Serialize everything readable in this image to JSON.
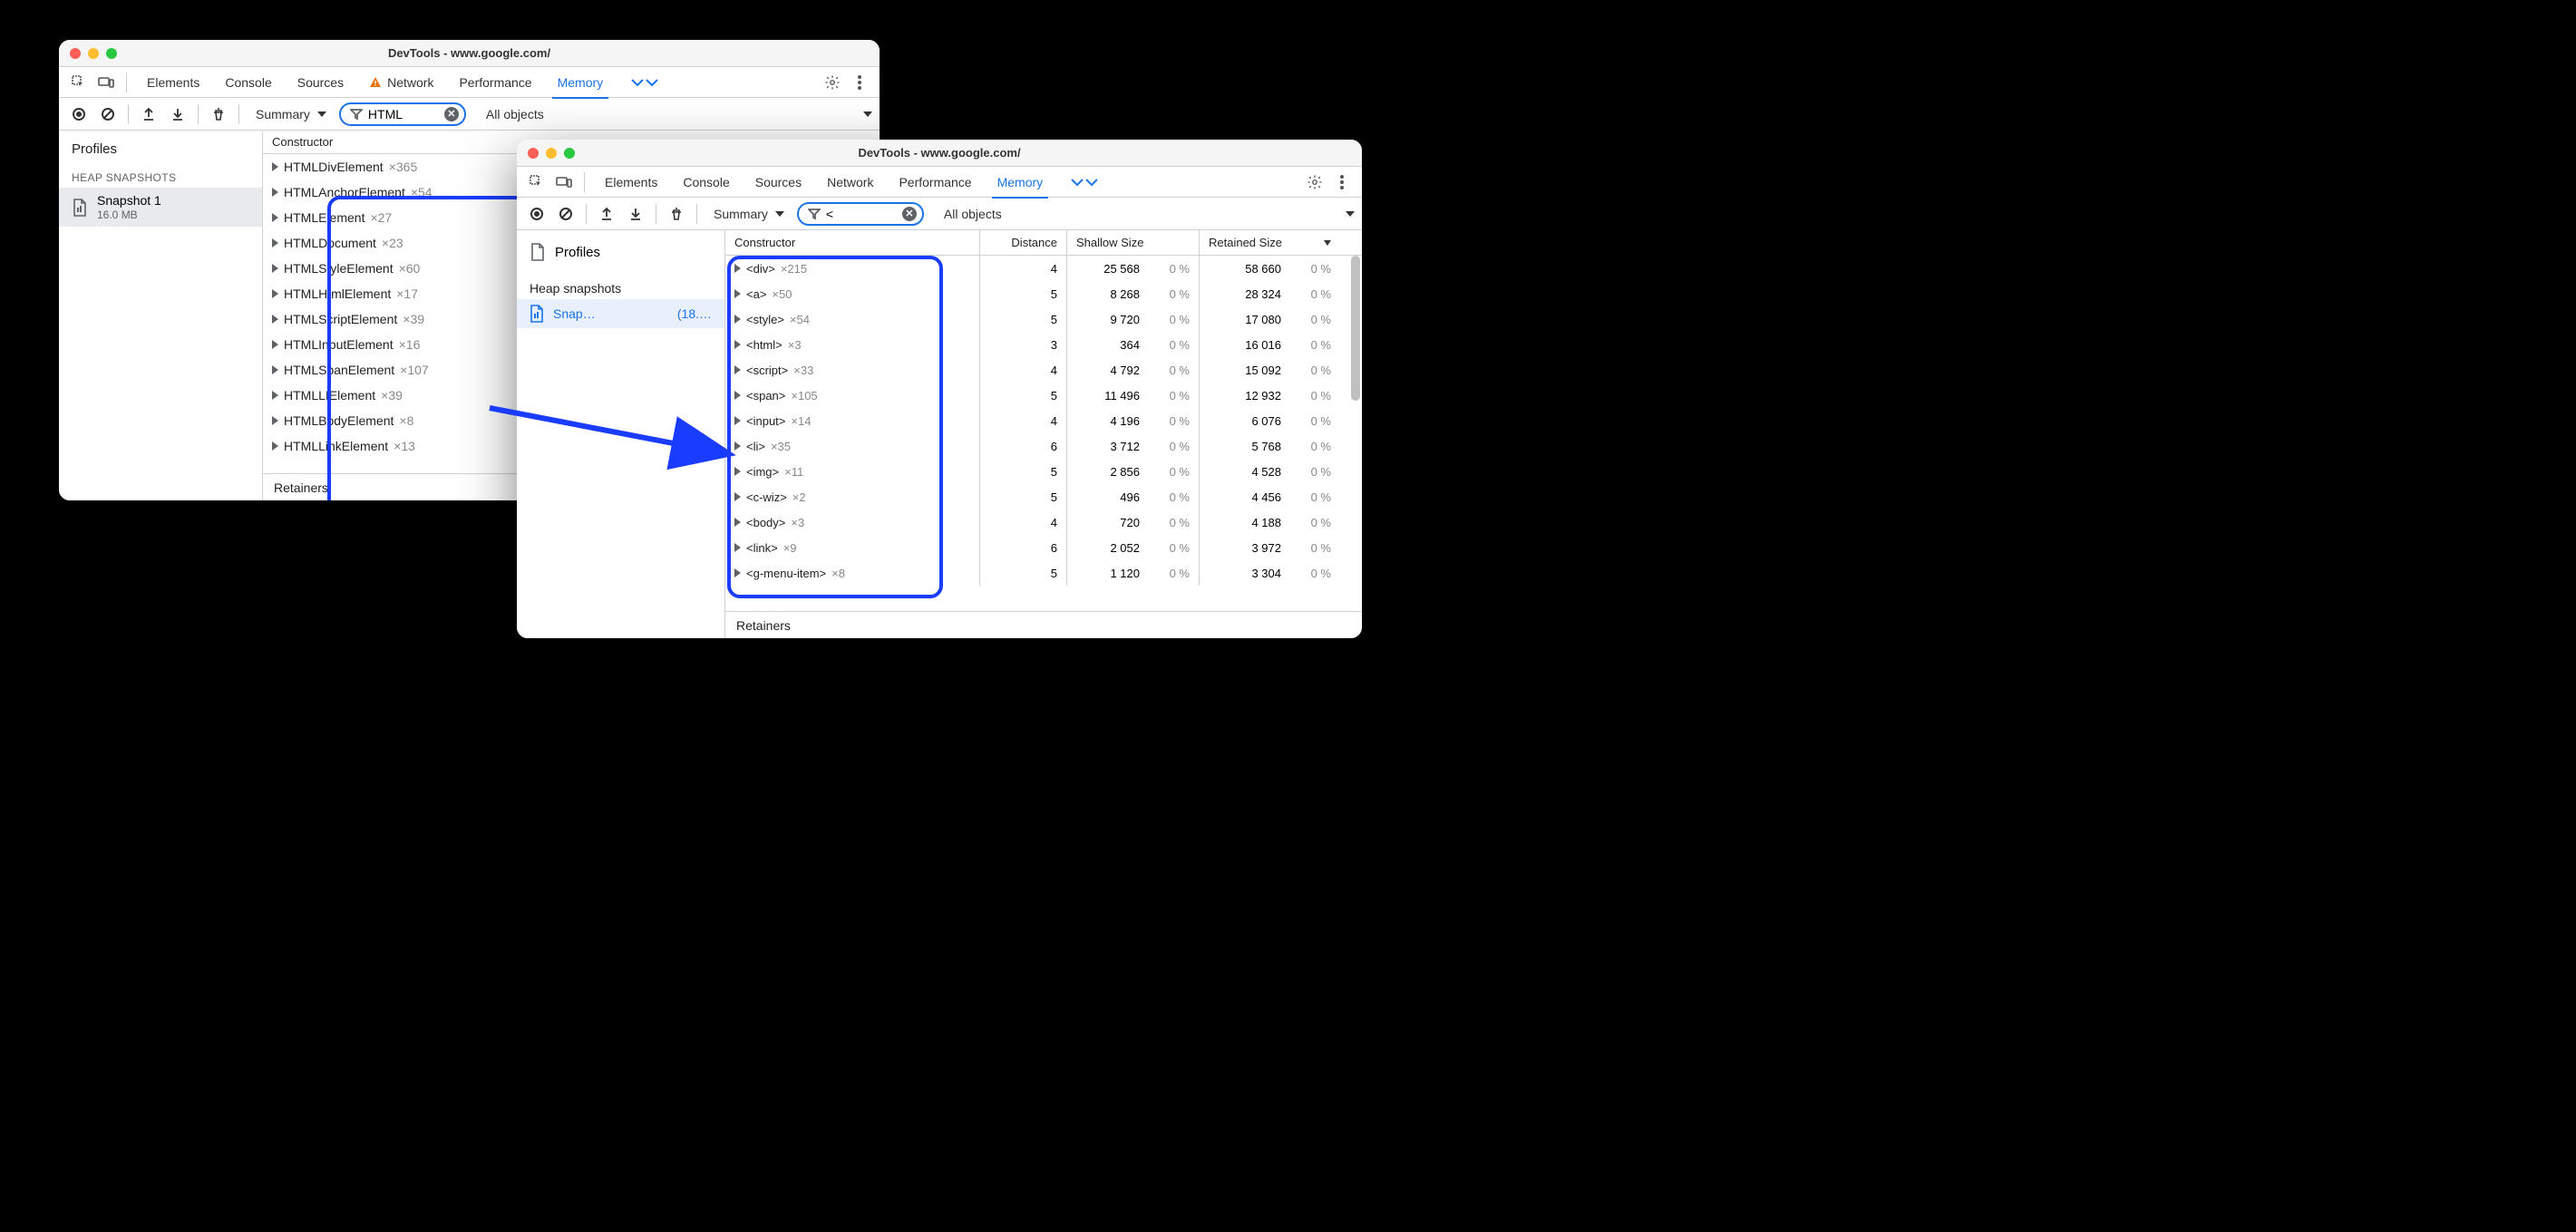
{
  "window1": {
    "title": "DevTools - www.google.com/",
    "tabs": [
      "Elements",
      "Console",
      "Sources",
      "Network",
      "Performance",
      "Memory"
    ],
    "warn_tab_index": 3,
    "active_tab_index": 5,
    "dropdown": "Summary",
    "filter_value": "HTML",
    "objects_dropdown": "All objects",
    "sidebar": {
      "title": "Profiles",
      "section": "HEAP SNAPSHOTS",
      "snapshot": {
        "name": "Snapshot 1",
        "size": "16.0 MB"
      }
    },
    "col_header": "Constructor",
    "rows": [
      {
        "name": "HTMLDivElement",
        "count": "×365"
      },
      {
        "name": "HTMLAnchorElement",
        "count": "×54"
      },
      {
        "name": "HTMLElement",
        "count": "×27"
      },
      {
        "name": "HTMLDocument",
        "count": "×23"
      },
      {
        "name": "HTMLStyleElement",
        "count": "×60"
      },
      {
        "name": "HTMLHtmlElement",
        "count": "×17"
      },
      {
        "name": "HTMLScriptElement",
        "count": "×39"
      },
      {
        "name": "HTMLInputElement",
        "count": "×16"
      },
      {
        "name": "HTMLSpanElement",
        "count": "×107"
      },
      {
        "name": "HTMLLIElement",
        "count": "×39"
      },
      {
        "name": "HTMLBodyElement",
        "count": "×8"
      },
      {
        "name": "HTMLLinkElement",
        "count": "×13"
      }
    ],
    "retainers": "Retainers"
  },
  "window2": {
    "title": "DevTools - www.google.com/",
    "tabs": [
      "Elements",
      "Console",
      "Sources",
      "Network",
      "Performance",
      "Memory"
    ],
    "active_tab_index": 5,
    "dropdown": "Summary",
    "filter_value": "<",
    "objects_dropdown": "All objects",
    "sidebar": {
      "title": "Profiles",
      "section": "Heap snapshots",
      "snapshot": {
        "name": "Snap…",
        "size": "(18.…"
      }
    },
    "columns": [
      "Constructor",
      "Distance",
      "Shallow Size",
      "Retained Size"
    ],
    "rows": [
      {
        "name": "<div>",
        "count": "×215",
        "dist": "4",
        "sh": "25 568",
        "shp": "0 %",
        "ret": "58 660",
        "retp": "0 %"
      },
      {
        "name": "<a>",
        "count": "×50",
        "dist": "5",
        "sh": "8 268",
        "shp": "0 %",
        "ret": "28 324",
        "retp": "0 %"
      },
      {
        "name": "<style>",
        "count": "×54",
        "dist": "5",
        "sh": "9 720",
        "shp": "0 %",
        "ret": "17 080",
        "retp": "0 %"
      },
      {
        "name": "<html>",
        "count": "×3",
        "dist": "3",
        "sh": "364",
        "shp": "0 %",
        "ret": "16 016",
        "retp": "0 %"
      },
      {
        "name": "<script>",
        "count": "×33",
        "dist": "4",
        "sh": "4 792",
        "shp": "0 %",
        "ret": "15 092",
        "retp": "0 %"
      },
      {
        "name": "<span>",
        "count": "×105",
        "dist": "5",
        "sh": "11 496",
        "shp": "0 %",
        "ret": "12 932",
        "retp": "0 %"
      },
      {
        "name": "<input>",
        "count": "×14",
        "dist": "4",
        "sh": "4 196",
        "shp": "0 %",
        "ret": "6 076",
        "retp": "0 %"
      },
      {
        "name": "<li>",
        "count": "×35",
        "dist": "6",
        "sh": "3 712",
        "shp": "0 %",
        "ret": "5 768",
        "retp": "0 %"
      },
      {
        "name": "<img>",
        "count": "×11",
        "dist": "5",
        "sh": "2 856",
        "shp": "0 %",
        "ret": "4 528",
        "retp": "0 %"
      },
      {
        "name": "<c-wiz>",
        "count": "×2",
        "dist": "5",
        "sh": "496",
        "shp": "0 %",
        "ret": "4 456",
        "retp": "0 %"
      },
      {
        "name": "<body>",
        "count": "×3",
        "dist": "4",
        "sh": "720",
        "shp": "0 %",
        "ret": "4 188",
        "retp": "0 %"
      },
      {
        "name": "<link>",
        "count": "×9",
        "dist": "6",
        "sh": "2 052",
        "shp": "0 %",
        "ret": "3 972",
        "retp": "0 %"
      },
      {
        "name": "<g-menu-item>",
        "count": "×8",
        "dist": "5",
        "sh": "1 120",
        "shp": "0 %",
        "ret": "3 304",
        "retp": "0 %"
      }
    ],
    "retainers": "Retainers"
  }
}
